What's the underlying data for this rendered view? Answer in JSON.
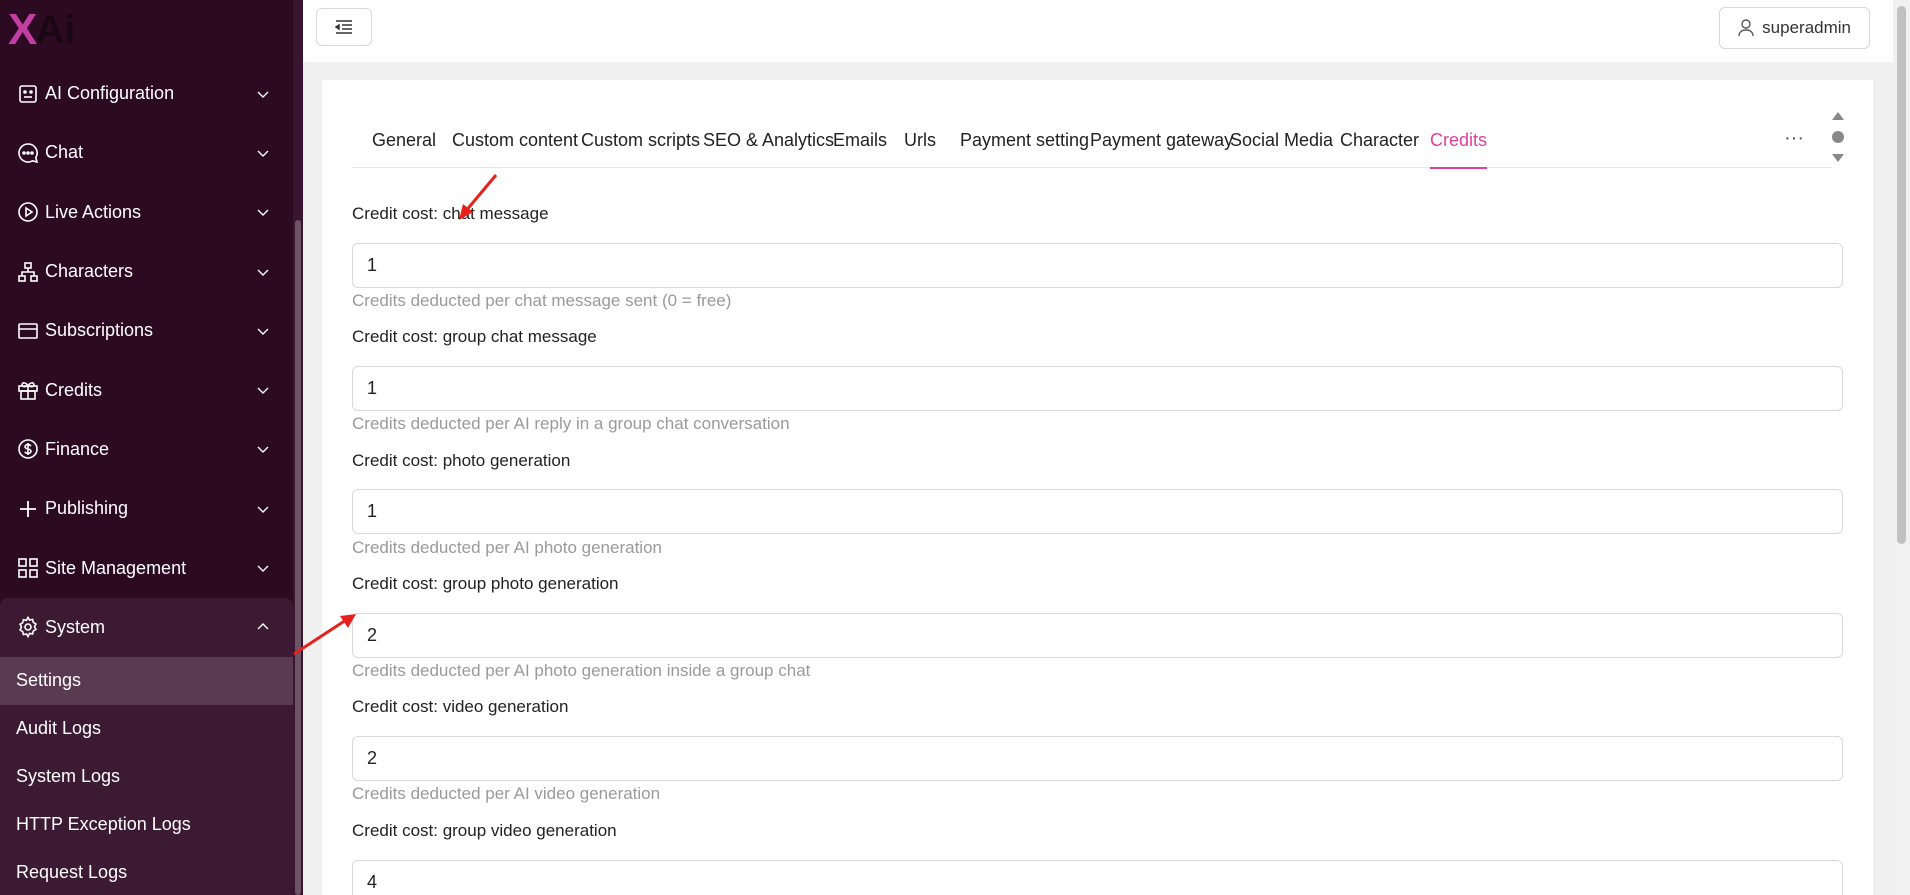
{
  "app": {
    "logo_x": "X",
    "logo_ai": "Ai",
    "accent_color": "#e0409a",
    "sidebar_bg": "#2c0a22"
  },
  "sidebar": {
    "items": [
      {
        "label": "AI Configuration",
        "icon": "robot-icon"
      },
      {
        "label": "Chat",
        "icon": "chat-bubble-icon"
      },
      {
        "label": "Live Actions",
        "icon": "play-circle-icon"
      },
      {
        "label": "Characters",
        "icon": "hierarchy-icon"
      },
      {
        "label": "Subscriptions",
        "icon": "card-icon"
      },
      {
        "label": "Credits",
        "icon": "gift-icon"
      },
      {
        "label": "Finance",
        "icon": "dollar-circle-icon"
      },
      {
        "label": "Publishing",
        "icon": "plus-icon"
      },
      {
        "label": "Site Management",
        "icon": "grid-icon"
      },
      {
        "label": "System",
        "icon": "gear-icon"
      }
    ],
    "system_subitems": [
      {
        "label": "Settings",
        "active": true
      },
      {
        "label": "Audit Logs"
      },
      {
        "label": "System Logs"
      },
      {
        "label": "HTTP Exception Logs"
      },
      {
        "label": "Request Logs"
      }
    ]
  },
  "topbar": {
    "menu_icon": "menu-fold-icon",
    "user_label": "superadmin",
    "user_icon": "user-icon"
  },
  "tabs": [
    {
      "label": "General"
    },
    {
      "label": "Custom content"
    },
    {
      "label": "Custom scripts"
    },
    {
      "label": "SEO & Analytics"
    },
    {
      "label": "Emails"
    },
    {
      "label": "Urls"
    },
    {
      "label": "Payment setting"
    },
    {
      "label": "Payment gateway"
    },
    {
      "label": "Social Media"
    },
    {
      "label": "Character"
    },
    {
      "label": "Credits",
      "active": true
    }
  ],
  "tab_more": "···",
  "fields": [
    {
      "label": "Credit cost: chat message",
      "value": "1",
      "help": "Credits deducted per chat message sent (0 = free)"
    },
    {
      "label": "Credit cost: group chat message",
      "value": "1",
      "help": "Credits deducted per AI reply in a group chat conversation"
    },
    {
      "label": "Credit cost: photo generation",
      "value": "1",
      "help": "Credits deducted per AI photo generation"
    },
    {
      "label": "Credit cost: group photo generation",
      "value": "2",
      "help": "Credits deducted per AI photo generation inside a group chat"
    },
    {
      "label": "Credit cost: video generation",
      "value": "2",
      "help": "Credits deducted per AI video generation"
    },
    {
      "label": "Credit cost: group video generation",
      "value": "4",
      "help": ""
    }
  ]
}
